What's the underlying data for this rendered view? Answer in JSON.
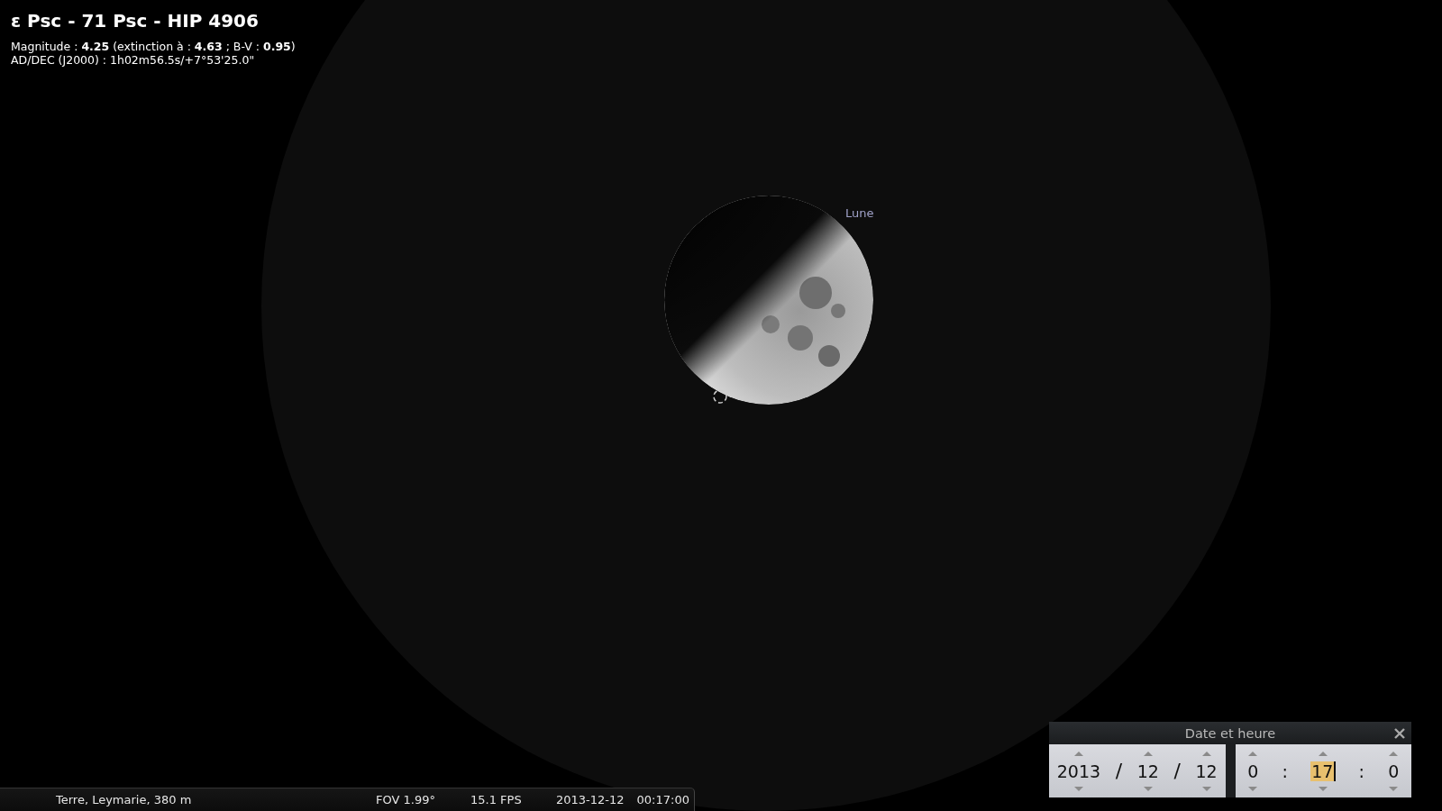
{
  "selected_object": {
    "title": "ε Psc - 71 Psc - HIP 4906",
    "details": [
      "Magnitude : **4.25** (extinction à  : **4.63** ; B-V : **0.95**)",
      "AD/DEC (J2000) : 1h02m56.5s/+7°53'25.0\""
    ]
  },
  "sky": {
    "moon_label": "Lune"
  },
  "date_dialog": {
    "title": "Date et heure",
    "date_fields": [
      {
        "value": "2013",
        "selected": false
      },
      {
        "value": "12",
        "selected": false
      },
      {
        "value": "12",
        "selected": false
      }
    ],
    "date_separators": [
      "/",
      "/"
    ],
    "time_fields": [
      {
        "value": "0",
        "selected": false
      },
      {
        "value": "17",
        "selected": true
      },
      {
        "value": "0",
        "selected": false
      }
    ],
    "time_separators": [
      ":",
      ":"
    ]
  },
  "status_bar": {
    "location": "Terre, Leymarie, 380 m",
    "fov": "FOV 1.99°",
    "fps": "15.1 FPS",
    "date": "2013-12-12",
    "time": "00:17:00"
  }
}
